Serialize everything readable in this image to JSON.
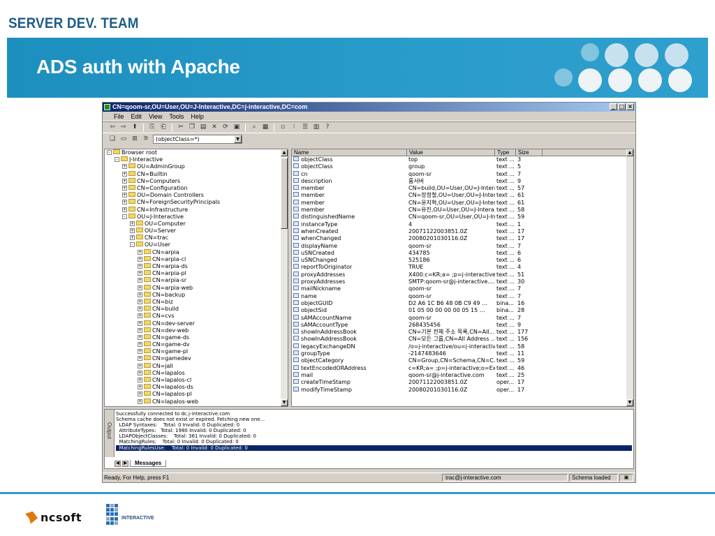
{
  "slide": {
    "team": "SERVER DEV. TEAM",
    "title": "ADS auth with Apache"
  },
  "window": {
    "title": "CN=qoom-sr,OU=User,OU=J-Interactive,DC=j-interactive,DC=com",
    "min": "_",
    "max": "□",
    "close": "×"
  },
  "menu": [
    "File",
    "Edit",
    "View",
    "Tools",
    "Help"
  ],
  "filter": "(objectClass=*)",
  "tree": [
    {
      "label": "Browser root",
      "depth": 0,
      "sign": "-"
    },
    {
      "label": "J-Interactive",
      "depth": 1,
      "sign": "-"
    },
    {
      "label": "OU=AdminGroup",
      "depth": 2,
      "sign": "+"
    },
    {
      "label": "CN=Builtin",
      "depth": 2,
      "sign": "+"
    },
    {
      "label": "CN=Computers",
      "depth": 2,
      "sign": "+"
    },
    {
      "label": "CN=Configuration",
      "depth": 2,
      "sign": "+"
    },
    {
      "label": "OU=Domain Controllers",
      "depth": 2,
      "sign": "+"
    },
    {
      "label": "CN=ForeignSecurityPrincipals",
      "depth": 2,
      "sign": "+"
    },
    {
      "label": "CN=Infrastructure",
      "depth": 2,
      "sign": "+"
    },
    {
      "label": "OU=J-Interactive",
      "depth": 2,
      "sign": "-"
    },
    {
      "label": "OU=Computer",
      "depth": 3,
      "sign": "+"
    },
    {
      "label": "OU=Server",
      "depth": 3,
      "sign": "+"
    },
    {
      "label": "CN=trac",
      "depth": 3,
      "sign": "+"
    },
    {
      "label": "OU=User",
      "depth": 3,
      "sign": "-"
    },
    {
      "label": "CN=arpia",
      "depth": 4,
      "sign": "+"
    },
    {
      "label": "CN=arpia-cl",
      "depth": 4,
      "sign": "+"
    },
    {
      "label": "CN=arpia-ds",
      "depth": 4,
      "sign": "+"
    },
    {
      "label": "CN=arpia-pl",
      "depth": 4,
      "sign": "+"
    },
    {
      "label": "CN=arpia-sr",
      "depth": 4,
      "sign": "+"
    },
    {
      "label": "CN=arpia-web",
      "depth": 4,
      "sign": "+"
    },
    {
      "label": "CN=backup",
      "depth": 4,
      "sign": "+"
    },
    {
      "label": "CN=biz",
      "depth": 4,
      "sign": "+"
    },
    {
      "label": "CN=build",
      "depth": 4,
      "sign": "+"
    },
    {
      "label": "CN=cvs",
      "depth": 4,
      "sign": "+"
    },
    {
      "label": "CN=dev-server",
      "depth": 4,
      "sign": "+"
    },
    {
      "label": "CN=dev-web",
      "depth": 4,
      "sign": "+"
    },
    {
      "label": "CN=game-ds",
      "depth": 4,
      "sign": "+"
    },
    {
      "label": "CN=game-dv",
      "depth": 4,
      "sign": "+"
    },
    {
      "label": "CN=game-pl",
      "depth": 4,
      "sign": "+"
    },
    {
      "label": "CN=gamedev",
      "depth": 4,
      "sign": "+"
    },
    {
      "label": "CN=jall",
      "depth": 4,
      "sign": "+"
    },
    {
      "label": "CN=lapalos",
      "depth": 4,
      "sign": "+"
    },
    {
      "label": "CN=lapalos-cl",
      "depth": 4,
      "sign": "+"
    },
    {
      "label": "CN=lapalos-ds",
      "depth": 4,
      "sign": "+"
    },
    {
      "label": "CN=lapalos-pl",
      "depth": 4,
      "sign": "+"
    },
    {
      "label": "CN=lapalos-web",
      "depth": 4,
      "sign": "+"
    }
  ],
  "columns": [
    "Name",
    "Value",
    "Type",
    "Size"
  ],
  "rows": [
    [
      "objectClass",
      "top",
      "text ...",
      "3"
    ],
    [
      "objectClass",
      "group",
      "text ...",
      "5"
    ],
    [
      "cn",
      "qoom-sr",
      "text ...",
      "7"
    ],
    [
      "description",
      "룸서버",
      "text ...",
      "9"
    ],
    [
      "member",
      "CN=build,OU=User,OU=J-Intera...",
      "text ...",
      "57"
    ],
    [
      "member",
      "CN=장정철,OU=User,OU=J-Inter...",
      "text ...",
      "61"
    ],
    [
      "member",
      "CN=윤지혁,OU=User,OU=J-Inter...",
      "text ...",
      "61"
    ],
    [
      "member",
      "CN=유진,OU=User,OU=J-Intera...",
      "text ...",
      "58"
    ],
    [
      "distinguishedName",
      "CN=qoom-sr,OU=User,OU=J-In...",
      "text ...",
      "59"
    ],
    [
      "instanceType",
      "4",
      "text ...",
      "1"
    ],
    [
      "whenCreated",
      "20071122003851.0Z",
      "text ...",
      "17"
    ],
    [
      "whenChanged",
      "20080201030116.0Z",
      "text ...",
      "17"
    ],
    [
      "displayName",
      "qoom-sr",
      "text ...",
      "7"
    ],
    [
      "uSNCreated",
      "434785",
      "text ...",
      "6"
    ],
    [
      "uSNChanged",
      "525186",
      "text ...",
      "6"
    ],
    [
      "reportToOriginator",
      "TRUE",
      "text ...",
      "4"
    ],
    [
      "proxyAddresses",
      "X400:c=KR;a= ;p=j-interactive;o...",
      "text ...",
      "51"
    ],
    [
      "proxyAddresses",
      "SMTP:qoom-sr@j-interactive....",
      "text ...",
      "30"
    ],
    [
      "mailNickname",
      "qoom-sr",
      "text ...",
      "7"
    ],
    [
      "name",
      "qoom-sr",
      "text ...",
      "7"
    ],
    [
      "objectGUID",
      "D2 A6 1C B6 48 0B C9 49 ...",
      "bina...",
      "16"
    ],
    [
      "objectSid",
      "01 05 00 00 00 00 05 15 ...",
      "bina...",
      "28"
    ],
    [
      "sAMAccountName",
      "qoom-sr",
      "text ...",
      "7"
    ],
    [
      "sAMAccountType",
      "268435456",
      "text ...",
      "9"
    ],
    [
      "showInAddressBook",
      "CN=기본 전체 주소 목록,CN=All...",
      "text ...",
      "177"
    ],
    [
      "showInAddressBook",
      "CN=모든 그룹,CN=All Address ...",
      "text ...",
      "156"
    ],
    [
      "legacyExchangeDN",
      "/o=j-interactive/ou=j-interactiv...",
      "text ...",
      "58"
    ],
    [
      "groupType",
      "-2147483646",
      "text ...",
      "11"
    ],
    [
      "objectCategory",
      "CN=Group,CN=Schema,CN=C...",
      "text ...",
      "59"
    ],
    [
      "textEncodedORAddress",
      "c=KR;a= ;p=j-interactive;o=Exc...",
      "text ...",
      "46"
    ],
    [
      "mail",
      "qoom-sr@j-interactive.com",
      "text ...",
      "25"
    ],
    [
      "createTimeStamp",
      "20071122003851.0Z",
      "oper...",
      "17"
    ],
    [
      "modifyTimeStamp",
      "20080201030116.0Z",
      "oper...",
      "17"
    ]
  ],
  "output": {
    "label": "Output",
    "lines": [
      "Successfully connected to dc.j-interactive.com",
      "Schema cache does not exist or expired. Fetching new one...",
      "  LDAP Syntaxes:    Total: 0 Invalid: 0 Duplicated: 0",
      "  AttributeTypes:   Total: 1980 Invalid: 0 Duplicated: 0",
      "  LDAPObjectClasses:    Total: 361 Invalid: 0 Duplicated: 0",
      "  MatchingRules:    Total: 0 Invalid: 0 Duplicated: 0",
      "  MatchingRulesUse:    Total: 0 Invalid: 0 Duplicated: 0"
    ],
    "selected_index": 6,
    "tab": "Messages"
  },
  "status": {
    "help": "Ready, For Help, press F1",
    "connection": "trac@j-interactive.com",
    "schema": "Schema loaded"
  },
  "logos": {
    "ncsoft": "ncsoft",
    "interactive": "INTERACTIVE"
  }
}
